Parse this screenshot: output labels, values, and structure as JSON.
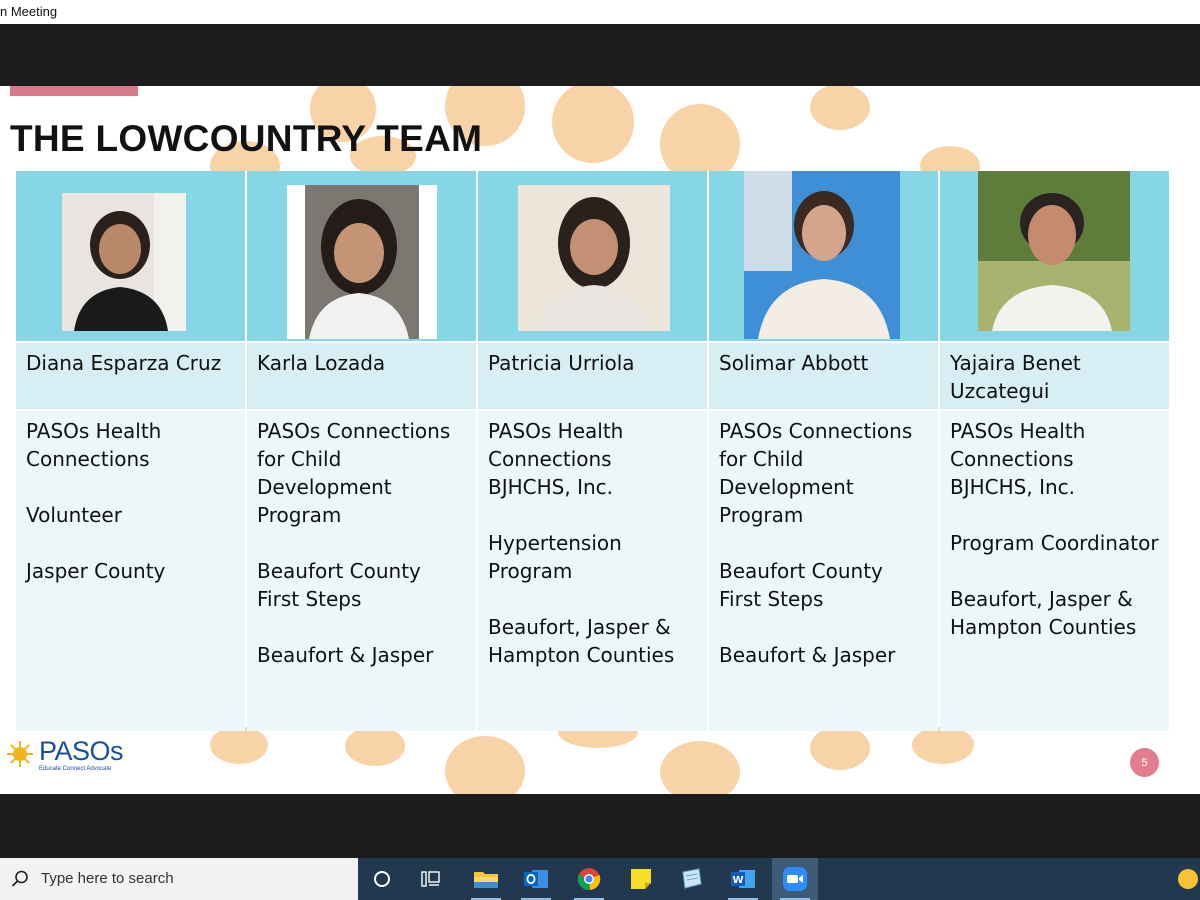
{
  "window": {
    "title": "n Meeting"
  },
  "slide": {
    "title": "THE LOWCOUNTRY TEAM",
    "page_number": "5",
    "logo": {
      "name": "PASOs",
      "tagline": "Educate Connect Advocate"
    },
    "colors": {
      "photo_bg": "#87d6e6",
      "name_bg": "#d6eef4",
      "info_bg": "#ecf7fa",
      "accent": "#d97a8a",
      "dots": "#f9d3a8"
    },
    "members": [
      {
        "name": "Diana Esparza Cruz",
        "organization": "PASOs Health Connections",
        "role": "Volunteer",
        "area": "Jasper County"
      },
      {
        "name": "Karla Lozada",
        "organization": "PASOs Connections for Child Development Program",
        "role": "Beaufort County First Steps",
        "area": "Beaufort & Jasper"
      },
      {
        "name": "Patricia Urriola",
        "organization": "PASOs Health Connections BJHCHS, Inc.",
        "role": "Hypertension Program",
        "area": "Beaufort, Jasper & Hampton Counties"
      },
      {
        "name": "Solimar Abbott",
        "organization": "PASOs Connections for Child Development Program",
        "role": "Beaufort County First Steps",
        "area": "Beaufort & Jasper"
      },
      {
        "name": "Yajaira Benet Uzcategui",
        "organization": "PASOs Health Connections BJHCHS, Inc.",
        "role": "Program Coordinator",
        "area": "Beaufort, Jasper & Hampton Counties"
      }
    ]
  },
  "taskbar": {
    "search_placeholder": "Type here to search",
    "icons": [
      "search-icon",
      "cortana-icon",
      "task-view-icon",
      "file-explorer-icon",
      "outlook-icon",
      "chrome-icon",
      "sticky-notes-icon",
      "notes-app-icon",
      "word-icon",
      "zoom-icon"
    ],
    "active_app": "zoom-icon"
  }
}
